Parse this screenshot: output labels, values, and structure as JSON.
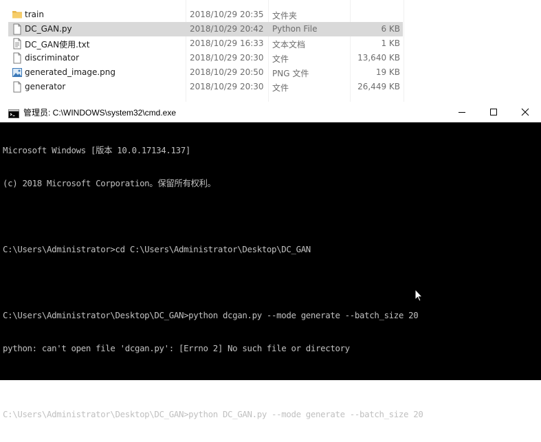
{
  "explorer": {
    "files": [
      {
        "name": "train",
        "date": "2018/10/29 20:35",
        "type": "文件夹",
        "size": "",
        "icon": "folder-icon"
      },
      {
        "name": "DC_GAN.py",
        "date": "2018/10/29 20:42",
        "type": "Python File",
        "size": "6 KB",
        "icon": "file-icon",
        "selected": true
      },
      {
        "name": "DC_GAN使用.txt",
        "date": "2018/10/29 16:33",
        "type": "文本文档",
        "size": "1 KB",
        "icon": "text-file-icon"
      },
      {
        "name": "discriminator",
        "date": "2018/10/29 20:30",
        "type": "文件",
        "size": "13,640 KB",
        "icon": "file-icon"
      },
      {
        "name": "generated_image.png",
        "date": "2018/10/29 20:50",
        "type": "PNG 文件",
        "size": "19 KB",
        "icon": "image-file-icon"
      },
      {
        "name": "generator",
        "date": "2018/10/29 20:30",
        "type": "文件",
        "size": "26,449 KB",
        "icon": "file-icon"
      }
    ]
  },
  "cmd": {
    "title": "管理员: C:\\WINDOWS\\system32\\cmd.exe",
    "lines": [
      "Microsoft Windows [版本 10.0.17134.137]",
      "(c) 2018 Microsoft Corporation。保留所有权利。",
      "",
      "C:\\Users\\Administrator>cd C:\\Users\\Administrator\\Desktop\\DC_GAN",
      "",
      "C:\\Users\\Administrator\\Desktop\\DC_GAN>python dcgan.py --mode generate --batch_size 20",
      "python: can't open file 'dcgan.py': [Errno 2] No such file or directory",
      "",
      "C:\\Users\\Administrator\\Desktop\\DC_GAN>python DC_GAN.py --mode generate --batch_size 20"
    ]
  },
  "colors": {
    "selected_row": "#d9d9d9",
    "console_bg": "#000000",
    "console_text": "#c0c0c0",
    "folder": "#e8b54a"
  }
}
